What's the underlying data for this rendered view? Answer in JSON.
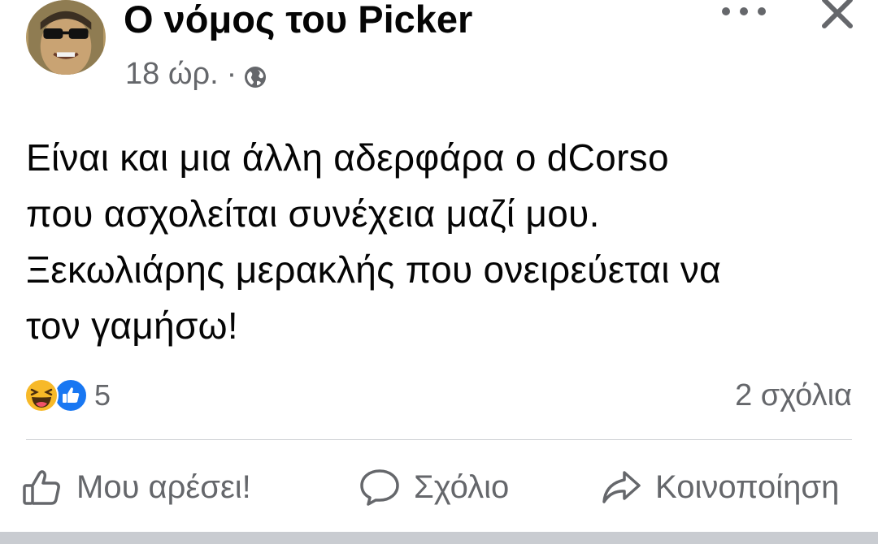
{
  "post": {
    "author": "Ο νόμος του Picker",
    "timestamp": "18 ώρ.",
    "separator": "·",
    "audience_icon": "globe-icon",
    "content_lines": [
      "Είναι και μια άλλη αδερφάρα ο dCorso",
      "που ασχολείται συνέχεια μαζί μου.",
      "Ξεκωλιάρης μερακλής που ονειρεύεται να",
      "τον γαμήσω!"
    ],
    "reactions": {
      "icons": [
        "haha-emoji-icon",
        "like-reaction-icon"
      ],
      "count": "5"
    },
    "comments_count": "2 σχόλια",
    "actions": {
      "like": "Μου αρέσει!",
      "comment": "Σχόλιο",
      "share": "Κοινοποίηση"
    }
  },
  "colors": {
    "text_primary": "#050505",
    "text_secondary": "#65676b",
    "like_blue": "#1877f2",
    "haha_yellow": "#f7b928",
    "divider": "#ced0d4"
  }
}
